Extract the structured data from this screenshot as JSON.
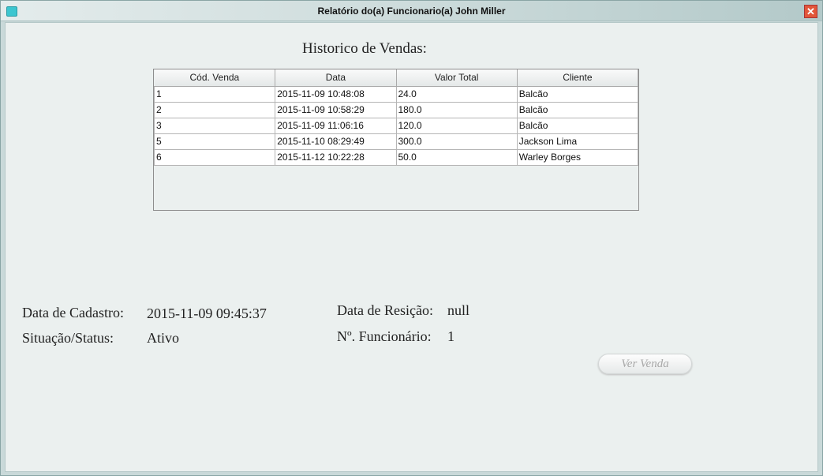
{
  "window": {
    "title": "Relatório do(a) Funcionario(a) John Miller"
  },
  "heading": "Historico de Vendas:",
  "table": {
    "columns": [
      "Cód. Venda",
      "Data",
      "Valor Total",
      "Cliente"
    ],
    "rows": [
      [
        "1",
        "2015-11-09 10:48:08",
        "24.0",
        "Balcão"
      ],
      [
        "2",
        "2015-11-09 10:58:29",
        "180.0",
        "Balcão"
      ],
      [
        "3",
        "2015-11-09 11:06:16",
        "120.0",
        "Balcão"
      ],
      [
        "5",
        "2015-11-10 08:29:49",
        "300.0",
        "Jackson Lima"
      ],
      [
        "6",
        "2015-11-12 10:22:28",
        "50.0",
        "Warley Borges"
      ]
    ]
  },
  "info": {
    "cadastro_label": "Data de Cadastro:",
    "cadastro_value": "2015-11-09 09:45:37",
    "status_label": "Situação/Status:",
    "status_value": "Ativo",
    "resicao_label": "Data de Resição:",
    "resicao_value": "null",
    "num_label": "Nº. Funcionário:",
    "num_value": "1"
  },
  "button": "Ver Venda"
}
